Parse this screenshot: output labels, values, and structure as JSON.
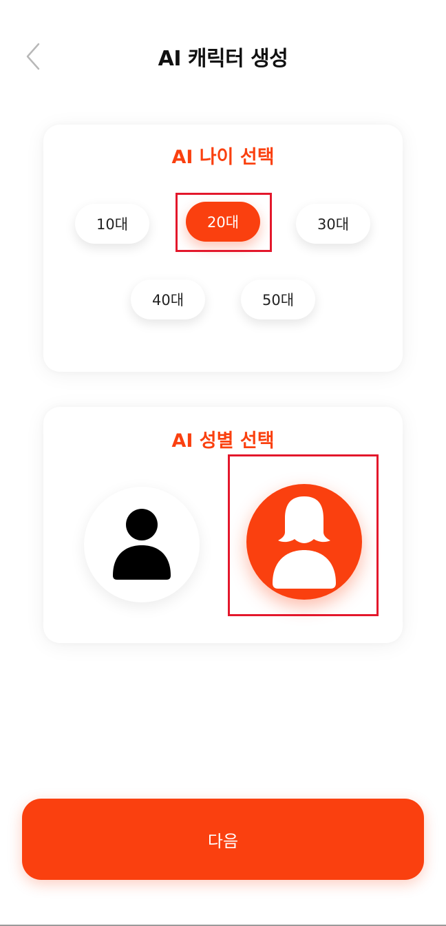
{
  "header": {
    "title": "AI 캐릭터 생성",
    "back_icon": "chevron-left-icon"
  },
  "age_section": {
    "title": "AI 나이 선택",
    "options": [
      "10대",
      "20대",
      "30대",
      "40대",
      "50대"
    ],
    "selected": "20대"
  },
  "gender_section": {
    "title": "AI 성별 선택",
    "options": [
      {
        "icon": "male-person-icon",
        "selected": false
      },
      {
        "icon": "female-person-icon",
        "selected": true
      }
    ]
  },
  "footer": {
    "next_label": "다음"
  },
  "colors": {
    "accent": "#fa400f",
    "highlight_border": "#e3172b",
    "text": "#111111"
  }
}
